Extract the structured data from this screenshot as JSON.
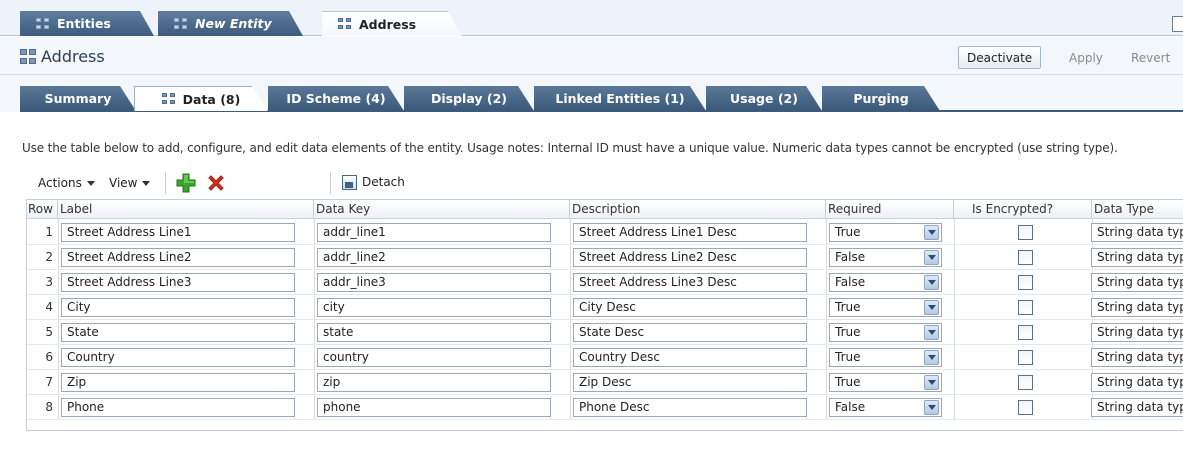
{
  "doc_tabs": [
    {
      "label": "Entities"
    },
    {
      "label": "New Entity"
    },
    {
      "label": "Address"
    }
  ],
  "header": {
    "title": "Address",
    "deactivate_label": "Deactivate",
    "apply_label": "Apply",
    "revert_label": "Revert"
  },
  "sub_tabs": [
    {
      "label": "Summary"
    },
    {
      "label": "Data (8)"
    },
    {
      "label": "ID Scheme (4)"
    },
    {
      "label": "Display (2)"
    },
    {
      "label": "Linked Entities (1)"
    },
    {
      "label": "Usage (2)"
    },
    {
      "label": "Purging"
    }
  ],
  "instructions": "Use the table below to add, configure, and edit data elements of the entity. Usage notes: Internal ID must have a unique value. Numeric data types cannot be encrypted (use string type).",
  "toolbar": {
    "actions_label": "Actions",
    "view_label": "View",
    "add_icon": "add-icon",
    "delete_icon": "delete-icon",
    "detach_label": "Detach"
  },
  "table": {
    "columns": [
      "Row",
      "Label",
      "Data Key",
      "Description",
      "Required",
      "Is Encrypted?",
      "Data Type"
    ],
    "rows": [
      {
        "row": "1",
        "label": "Street Address Line1",
        "data_key": "addr_line1",
        "description": "Street Address Line1 Desc",
        "required": "True",
        "encrypted": false,
        "data_type": "String data type"
      },
      {
        "row": "2",
        "label": "Street Address Line2",
        "data_key": "addr_line2",
        "description": "Street Address Line2 Desc",
        "required": "False",
        "encrypted": false,
        "data_type": "String data type"
      },
      {
        "row": "3",
        "label": "Street Address Line3",
        "data_key": "addr_line3",
        "description": "Street Address Line3 Desc",
        "required": "False",
        "encrypted": false,
        "data_type": "String data type"
      },
      {
        "row": "4",
        "label": "City",
        "data_key": "city",
        "description": "City Desc",
        "required": "True",
        "encrypted": false,
        "data_type": "String data type"
      },
      {
        "row": "5",
        "label": "State",
        "data_key": "state",
        "description": "State Desc",
        "required": "True",
        "encrypted": false,
        "data_type": "String data type"
      },
      {
        "row": "6",
        "label": "Country",
        "data_key": "country",
        "description": "Country Desc",
        "required": "True",
        "encrypted": false,
        "data_type": "String data type"
      },
      {
        "row": "7",
        "label": "Zip",
        "data_key": "zip",
        "description": "Zip Desc",
        "required": "True",
        "encrypted": false,
        "data_type": "String data type"
      },
      {
        "row": "8",
        "label": "Phone",
        "data_key": "phone",
        "description": "Phone Desc",
        "required": "False",
        "encrypted": false,
        "data_type": "String data type"
      }
    ]
  },
  "colors": {
    "tab_dark": "#3d5b7d",
    "add_green": "#3aa52a",
    "delete_red": "#d8321e"
  }
}
